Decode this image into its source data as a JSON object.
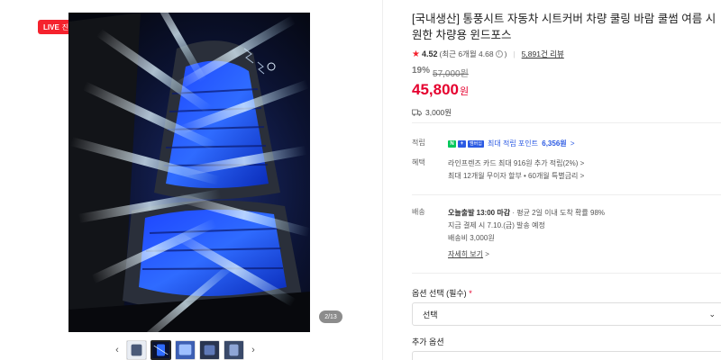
{
  "gallery": {
    "live_label": "LIVE",
    "live_status": "진행중",
    "live_chevron": ">",
    "page_counter": "2/13",
    "prev_arrow": "‹",
    "next_arrow": "›",
    "thumb_count": 5,
    "active_thumb_index": 1
  },
  "product": {
    "title": "[국내생산] 통풍시트 자동차 시트커버 차량 쿨링 바람 쿨썸 여름 시원한 차량용 윈드포스",
    "rating": "4.52",
    "recent_rating": "(최근 6개월 4.68",
    "recent_rating_close": ")",
    "info_icon": "i",
    "review_count": "5,891건 리뷰",
    "discount_rate": "19%",
    "original_price": "57,000원",
    "price": "45,800",
    "price_unit": "원",
    "shipping_fee": "3,000원"
  },
  "benefits": {
    "points_label": "적립",
    "npay_n": "N",
    "npay_plus": "+",
    "npay_membership": "멤버십",
    "points_text": "최대 적립 포인트",
    "points_value": "6,356원",
    "points_chevron": ">",
    "benefit_label": "혜택",
    "benefit_line1": "라인프렌즈 카드 최대 916원 추가 적립(2%)",
    "benefit_line1_chevron": ">",
    "benefit_line2": "최대 12개월 무이자 할부 • 60개월 특별금리",
    "benefit_line2_chevron": ">"
  },
  "delivery": {
    "label": "배송",
    "line1_bold": "오늘출발 13:00 마감",
    "line1_rest": "· 평균 2일 이내 도착 확률 98%",
    "line2": "지금 결제 시 7.10.(금) 발송 예정",
    "line3": "배송비 3,000원",
    "detail_link": "자세히 보기",
    "detail_chevron": ">"
  },
  "options": {
    "label": "옵션 선택 (필수)",
    "required_mark": "*",
    "selected_value": "선택",
    "caret": "⌄",
    "extra_label": "추가 옵션"
  },
  "colors": {
    "accent_red": "#e5002e",
    "live_red": "#f5222d",
    "naver_green": "#03c75a",
    "point_blue": "#2b5ae3"
  }
}
